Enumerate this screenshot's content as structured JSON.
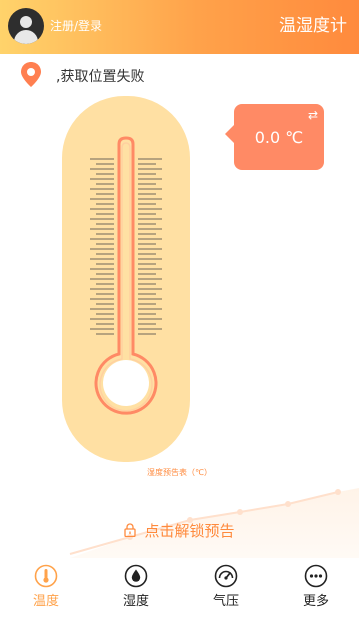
{
  "header": {
    "login_label": "注册/登录",
    "title": "温湿度计",
    "gradient": [
      "#ffd36b",
      "#ff8a3d"
    ]
  },
  "location": {
    "icon": "location-pin-icon",
    "text": ",获取位置失败"
  },
  "thermometer": {
    "reading": "0.0 ℃",
    "swap_icon_glyph": "⇄"
  },
  "forecast": {
    "label": "湿度预告表（℃）",
    "unlock_text": "点击解锁预告"
  },
  "tabs": [
    {
      "label": "温度",
      "icon": "thermometer-icon",
      "active": true
    },
    {
      "label": "湿度",
      "icon": "water-drop-icon",
      "active": false
    },
    {
      "label": "气压",
      "icon": "gauge-icon",
      "active": false
    },
    {
      "label": "更多",
      "icon": "more-dots-icon",
      "active": false
    }
  ],
  "colors": {
    "accent": "#ff8a3d",
    "thermo_bg": "#ffe0a3",
    "thermo_tube": "#ff8a65",
    "active_tab": "#ffa24a"
  }
}
